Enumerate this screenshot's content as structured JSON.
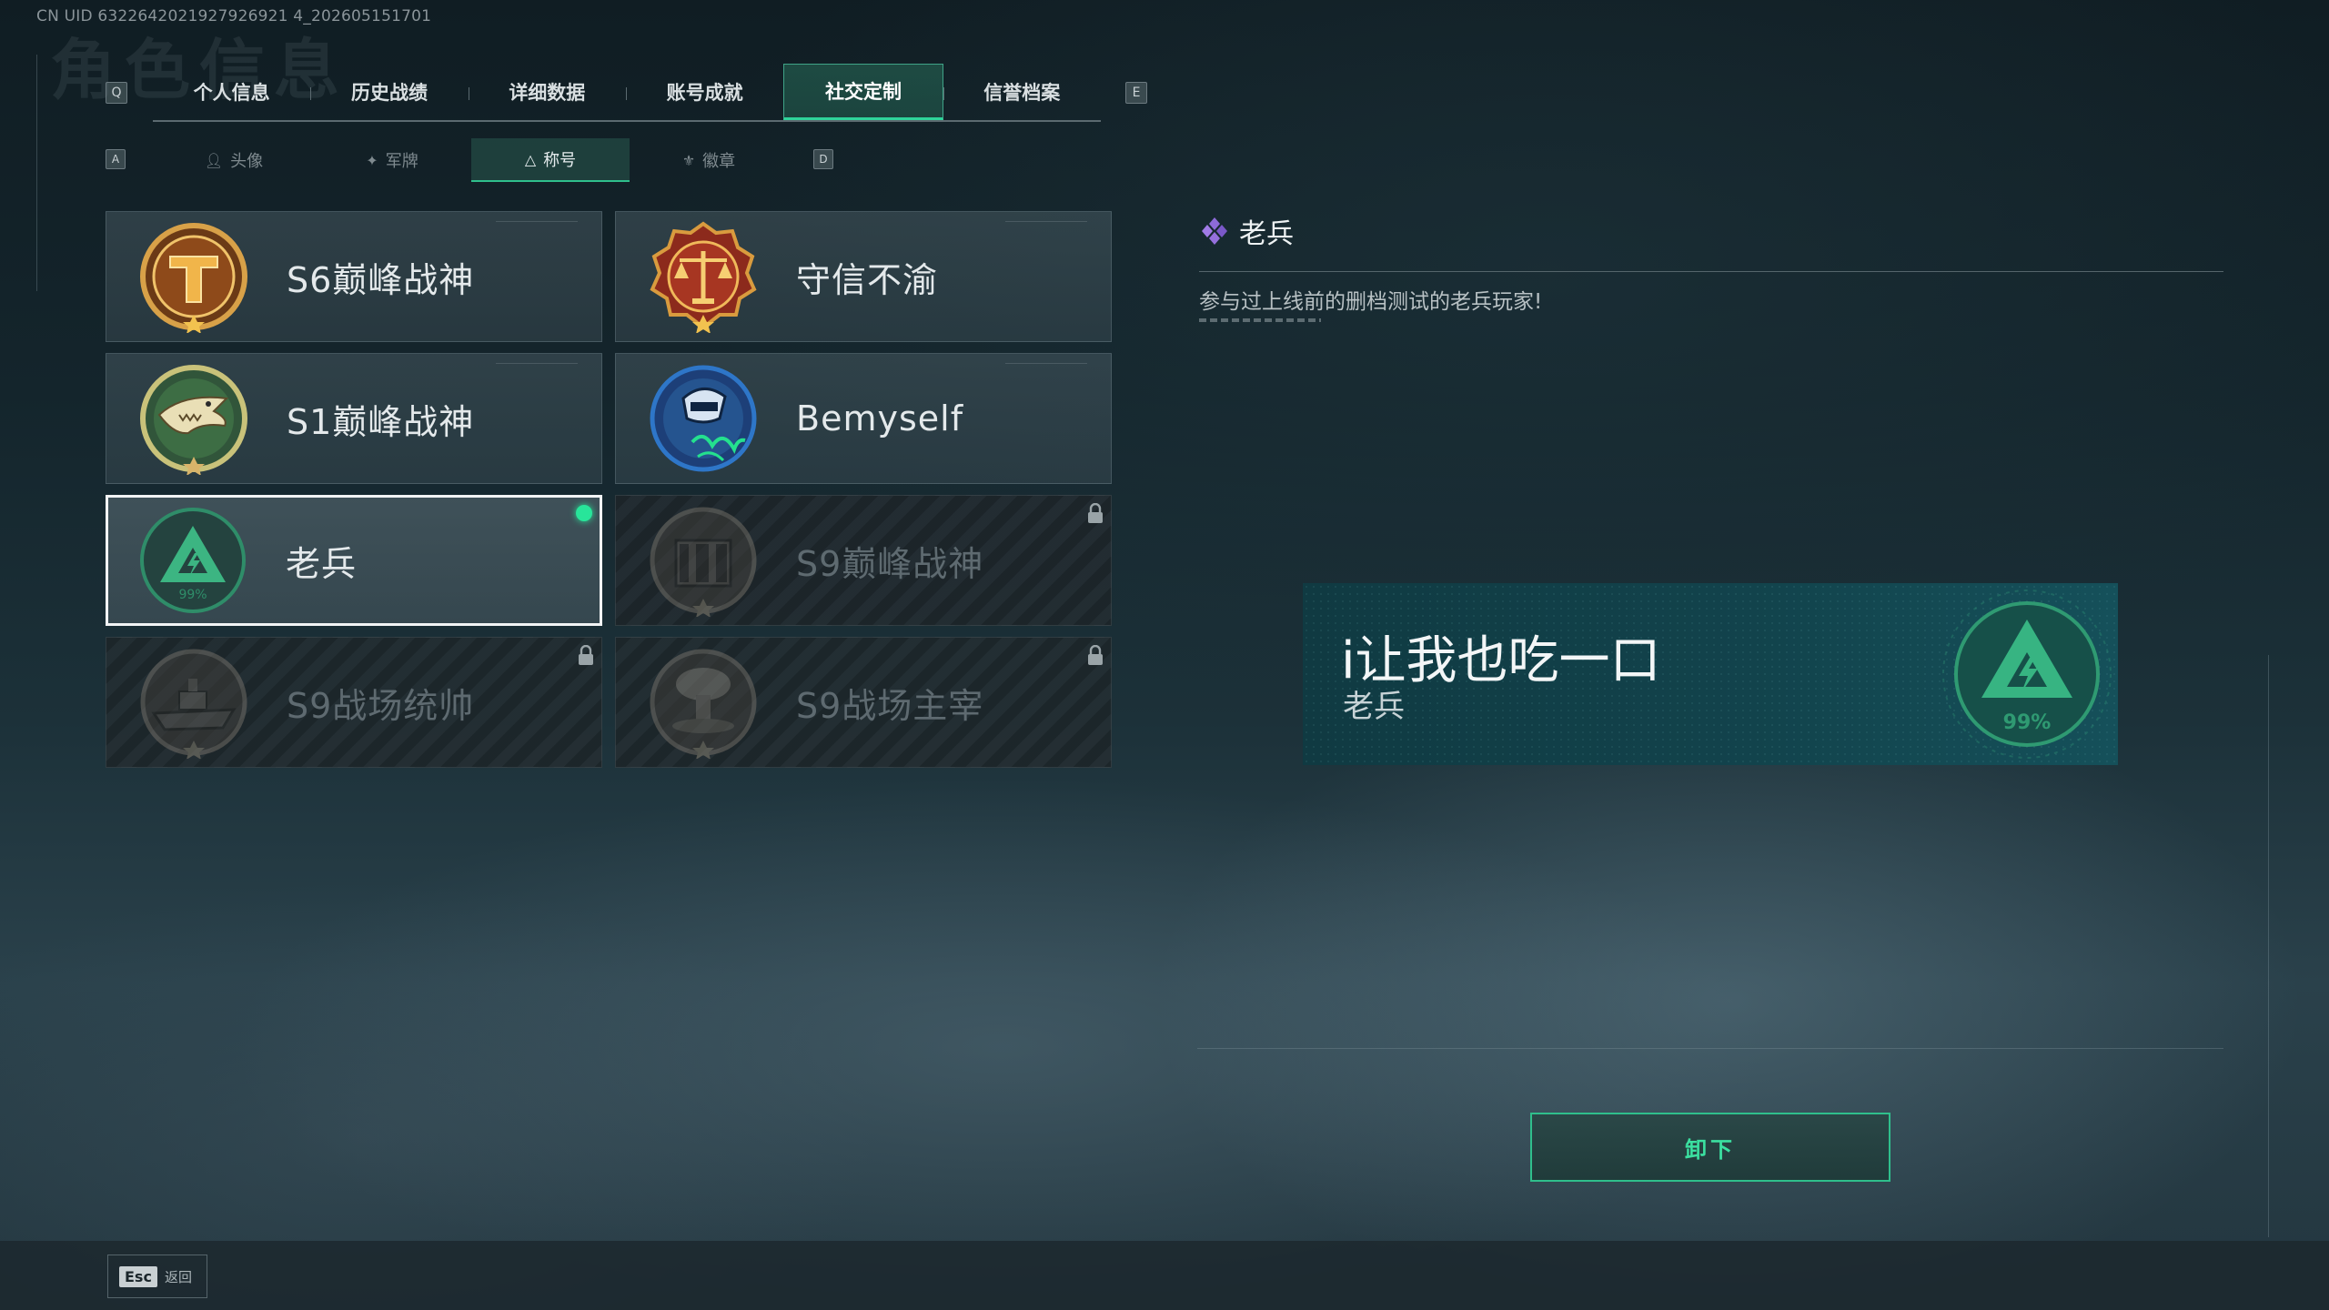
{
  "watermark": {
    "uid": "CN UID 6322642021927926921 4_202605151701",
    "background_title": "角色信息"
  },
  "main_tabs": {
    "prev_key": "Q",
    "next_key": "E",
    "items": [
      {
        "label": "个人信息"
      },
      {
        "label": "历史战绩"
      },
      {
        "label": "详细数据"
      },
      {
        "label": "账号成就"
      },
      {
        "label": "社交定制",
        "active": true
      },
      {
        "label": "信誉档案"
      }
    ]
  },
  "sub_tabs": {
    "prev_key": "A",
    "next_key": "D",
    "items": [
      {
        "label": "头像",
        "icon": "person-icon"
      },
      {
        "label": "军牌",
        "icon": "dogtag-icon"
      },
      {
        "label": "称号",
        "icon": "triangle-icon",
        "active": true
      },
      {
        "label": "徽章",
        "icon": "emblem-icon"
      }
    ]
  },
  "titles": [
    {
      "label": "S6巅峰战神",
      "badge": "s6-crest-icon",
      "locked": false
    },
    {
      "label": "守信不渝",
      "badge": "scales-crest-icon",
      "locked": false
    },
    {
      "label": "S1巅峰战神",
      "badge": "crocodile-crest-icon",
      "locked": false
    },
    {
      "label": "Bemyself",
      "badge": "bemyself-crest-icon",
      "locked": false
    },
    {
      "label": "老兵",
      "badge": "veteran-triangle-icon",
      "badge_text": "99%",
      "locked": false,
      "selected": true,
      "equipped": true
    },
    {
      "label": "S9巅峰战神",
      "badge": "building-crest-icon",
      "locked": true
    },
    {
      "label": "S9战场统帅",
      "badge": "battleship-crest-icon",
      "locked": true
    },
    {
      "label": "S9战场主宰",
      "badge": "mushroom-cloud-crest-icon",
      "locked": true
    }
  ],
  "detail": {
    "title": "老兵",
    "description": "参与过上线前的删档测试的老兵玩家!"
  },
  "preview": {
    "player_name": "i让我也吃一口",
    "title": "老兵",
    "badge_text": "99%"
  },
  "actions": {
    "unequip_label": "卸下"
  },
  "footer": {
    "esc_key": "Esc",
    "back_label": "返回"
  },
  "colors": {
    "accent": "#2fd39a",
    "equipped": "#28e59a",
    "preview_bg": "#12434c"
  }
}
